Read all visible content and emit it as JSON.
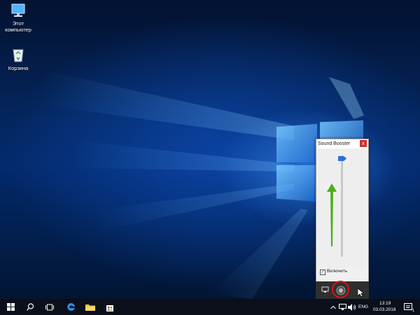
{
  "desktop": {
    "icons": [
      {
        "label": "Этот компьютер",
        "icon": "computer-icon"
      },
      {
        "label": "Корзина",
        "icon": "recycle-bin-icon"
      }
    ]
  },
  "sound_booster": {
    "title": "Sound Booster",
    "close_label": "x",
    "enable_label": "Включить",
    "enable_checked": true,
    "volume_level": 1.0
  },
  "taskbar": {
    "language": "ENG",
    "time": "13:19",
    "date": "03.03.2018",
    "notification_badge": "1"
  },
  "colors": {
    "accent": "#2d6fd6",
    "arrow": "#4caf1a",
    "highlight_ring": "#e01010",
    "close_button": "#d32f2f"
  }
}
